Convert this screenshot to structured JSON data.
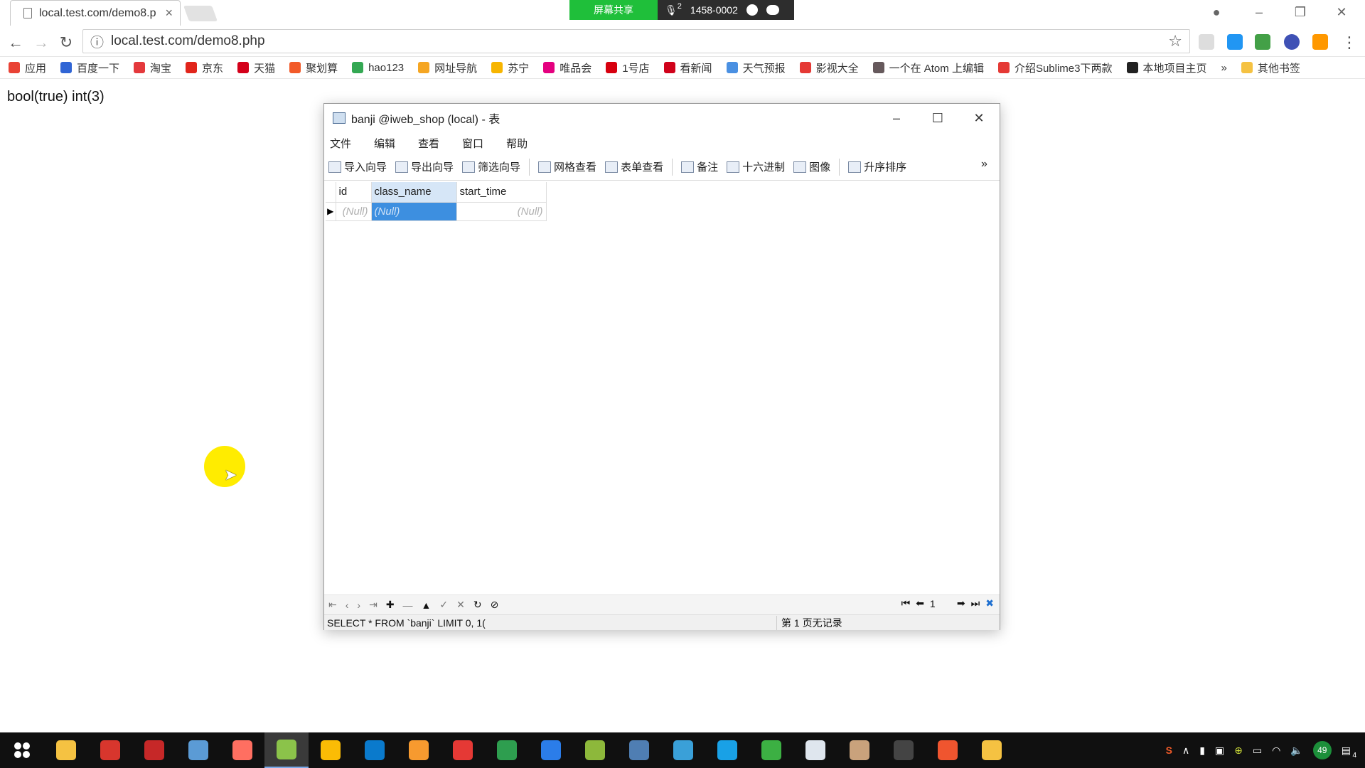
{
  "browser": {
    "tab_title": "local.test.com/demo8.p",
    "tab_close": "×",
    "url": "local.test.com/demo8.php",
    "info_icon": "ⓘ",
    "star_icon": "☆",
    "menu_icon": "⋮",
    "screen_share_label": "屏幕共享",
    "mic_count": "2",
    "meeting_id": "1458-0002"
  },
  "bookmarks": [
    {
      "label": "应用",
      "color": "#e94235"
    },
    {
      "label": "百度一下",
      "color": "#3065d5"
    },
    {
      "label": "淘宝",
      "color": "#e4393c"
    },
    {
      "label": "京东",
      "color": "#e1251b"
    },
    {
      "label": "天猫",
      "color": "#d4001a"
    },
    {
      "label": "聚划算",
      "color": "#f25a29"
    },
    {
      "label": "hao123",
      "color": "#34a853"
    },
    {
      "label": "网址导航",
      "color": "#f5a623"
    },
    {
      "label": "苏宁",
      "color": "#f7b500"
    },
    {
      "label": "唯品会",
      "color": "#e4007f"
    },
    {
      "label": "1号店",
      "color": "#d7000f"
    },
    {
      "label": "看新闻",
      "color": "#d0021b"
    },
    {
      "label": "天气预报",
      "color": "#4a90e2"
    },
    {
      "label": "影视大全",
      "color": "#e53935"
    },
    {
      "label": "一个在 Atom 上编辑",
      "color": "#66595c"
    },
    {
      "label": "介绍Sublime3下两款",
      "color": "#e53935"
    },
    {
      "label": "本地项目主页",
      "color": "#222222"
    }
  ],
  "bookmarks_overflow": "»",
  "other_bookmarks": "其他书签",
  "page": {
    "output_text": "bool(true) int(3)"
  },
  "navicat": {
    "title": "banji @iweb_shop (local) - 表",
    "menu": [
      "文件",
      "编辑",
      "查看",
      "窗口",
      "帮助"
    ],
    "toolbar": [
      "导入向导",
      "导出向导",
      "筛选向导",
      "网格查看",
      "表单查看",
      "备注",
      "十六进制",
      "图像",
      "升序排序"
    ],
    "toolbar_more": "»",
    "columns": [
      "id",
      "class_name",
      "start_time"
    ],
    "row": [
      "(Null)",
      "(Null)",
      "(Null)"
    ],
    "row_indicator": "▶",
    "page_number": "1",
    "sql": "SELECT * FROM `banji` LIMIT 0, 1(",
    "record_status": "第 1 页无记录"
  },
  "taskbar": {
    "apps": [
      {
        "name": "file-explorer-icon",
        "color": "#f5c242"
      },
      {
        "name": "snail-app-icon",
        "color": "#d8362d"
      },
      {
        "name": "pdf-app-icon",
        "color": "#c62828"
      },
      {
        "name": "network-app-icon",
        "color": "#5b9bd5"
      },
      {
        "name": "color-app-icon",
        "color": "#ff6f61"
      },
      {
        "name": "navicat-icon",
        "color": "#8bc34a"
      },
      {
        "name": "chrome-icon",
        "color": "#fbbc05"
      },
      {
        "name": "vscode-icon",
        "color": "#0a7acc"
      },
      {
        "name": "sublime-icon",
        "color": "#f79a2f"
      },
      {
        "name": "xmind-icon",
        "color": "#e53935"
      },
      {
        "name": "excel-app-icon",
        "color": "#2e9e4f"
      },
      {
        "name": "baidu-cloud-icon",
        "color": "#2b7de9"
      },
      {
        "name": "lambda-app-icon",
        "color": "#8db83b"
      },
      {
        "name": "virtualbox-icon",
        "color": "#4f7eb3"
      },
      {
        "name": "notepad-app-icon",
        "color": "#3aa0d8"
      },
      {
        "name": "goland-icon",
        "color": "#19a1e6"
      },
      {
        "name": "green-app-icon",
        "color": "#3cb043"
      },
      {
        "name": "document-app-icon",
        "color": "#dfe6ee"
      },
      {
        "name": "avatar-app-icon",
        "color": "#c9a27c"
      },
      {
        "name": "terminal-icon",
        "color": "#444444"
      },
      {
        "name": "burst-app-icon",
        "color": "#f0552f"
      },
      {
        "name": "folder-key-icon",
        "color": "#f5c242"
      }
    ],
    "badge_count": "49",
    "notification_count": "4"
  }
}
